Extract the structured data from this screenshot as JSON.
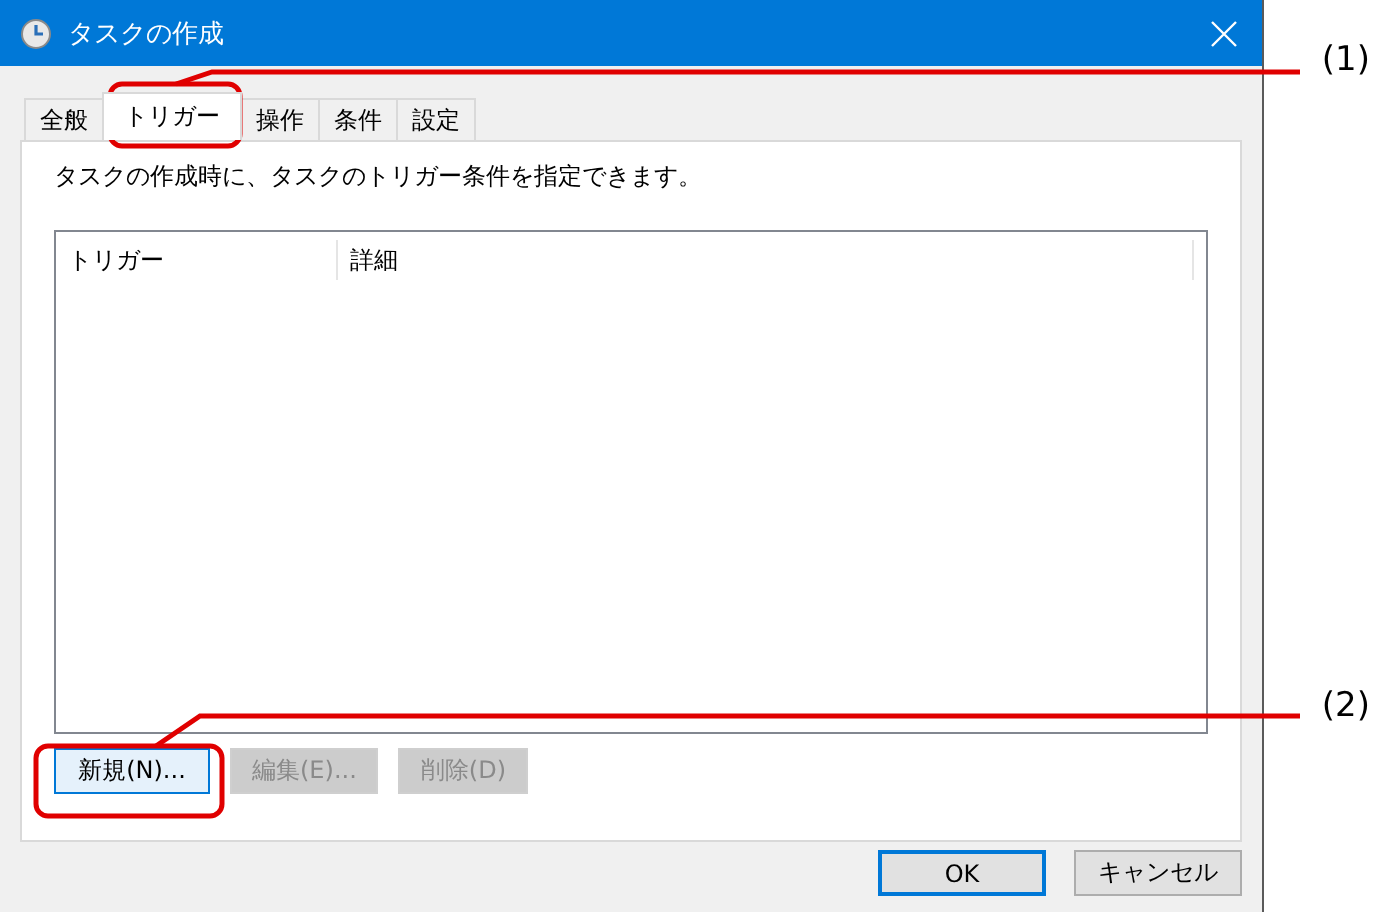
{
  "window": {
    "title": "タスクの作成"
  },
  "tabs": [
    {
      "label": "全般",
      "selected": false
    },
    {
      "label": "トリガー",
      "selected": true
    },
    {
      "label": "操作",
      "selected": false
    },
    {
      "label": "条件",
      "selected": false
    },
    {
      "label": "設定",
      "selected": false
    }
  ],
  "description": "タスクの作成時に、タスクのトリガー条件を指定できます。",
  "table": {
    "columns": [
      "トリガー",
      "詳細"
    ]
  },
  "list_buttons": [
    {
      "label": "新規(N)...",
      "disabled": false,
      "focused": true
    },
    {
      "label": "編集(E)...",
      "disabled": true,
      "focused": false
    },
    {
      "label": "削除(D)",
      "disabled": true,
      "focused": false
    }
  ],
  "dialog_buttons": [
    {
      "label": "OK",
      "default": true
    },
    {
      "label": "キャンセル",
      "default": false
    }
  ],
  "callouts": [
    {
      "label": "(1)"
    },
    {
      "label": "(2)"
    }
  ]
}
